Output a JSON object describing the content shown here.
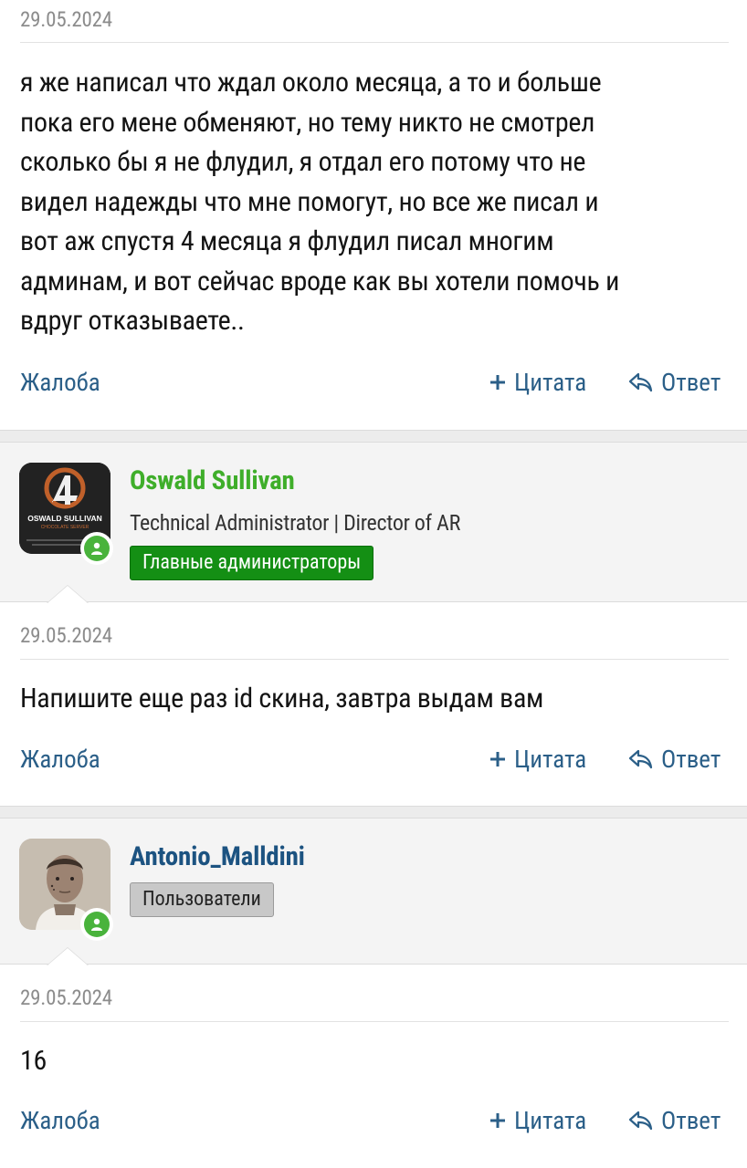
{
  "posts": [
    {
      "date": "29.05.2024",
      "lines": [
        "я же написал что ждал около месяца, а то и больше",
        "пока его мене обменяют, но тему никто не смотрел",
        "сколько бы я не флудил, я отдал его потому что не",
        "видел надежды что мне помогут, но все же писал и",
        "вот аж спустя 4 месяца я флудил писал многим",
        "админам, и вот сейчас вроде как вы хотели помочь и",
        "вдруг отказываете.."
      ]
    },
    {
      "author": {
        "name": "Oswald Sullivan",
        "name_color": "#3fae2a",
        "title": "Technical Administrator | Director of AR",
        "group": "Главные администраторы",
        "avatar_text": "OSWALD SULLIVAN",
        "avatar_subtext": "CHOCOLATE SERVER"
      },
      "date": "29.05.2024",
      "lines": [
        "Напишите еще раз id скина, завтра выдам вам"
      ]
    },
    {
      "author": {
        "name": "Antonio_Malldini",
        "name_color": "#1c5381",
        "group": "Пользователи"
      },
      "date": "29.05.2024",
      "lines": [
        "16"
      ]
    }
  ],
  "actions": {
    "report": "Жалоба",
    "quote": "Цитата",
    "reply": "Ответ"
  },
  "colors": {
    "link": "#2b5f88",
    "online": "#49b33c",
    "admin_badge": "#148f14",
    "user_badge": "#c8c8c8"
  }
}
